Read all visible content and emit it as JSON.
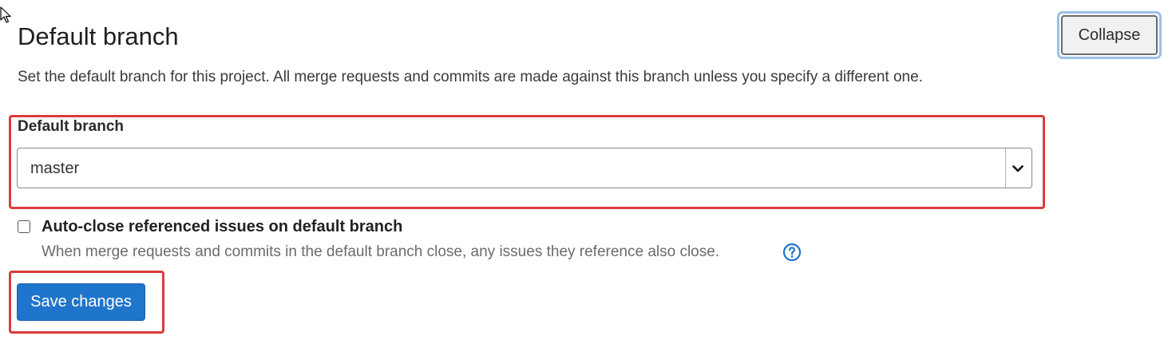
{
  "section": {
    "title": "Default branch",
    "description": "Set the default branch for this project. All merge requests and commits are made against this branch unless you specify a different one.",
    "collapse_label": "Collapse"
  },
  "branch_field": {
    "label": "Default branch",
    "selected_value": "master",
    "chevron_icon": "chevron-down-icon"
  },
  "auto_close": {
    "label": "Auto-close referenced issues on default branch",
    "help_text": "When merge requests and commits in the default branch close, any issues they reference also close.",
    "checked": false,
    "help_icon": "question-circle-icon"
  },
  "actions": {
    "save_label": "Save changes"
  },
  "colors": {
    "primary_button": "#1f75cb",
    "highlight_border": "#db3b3b",
    "focus_ring": "#9cc0ea",
    "help_icon": "#1f75cb"
  }
}
